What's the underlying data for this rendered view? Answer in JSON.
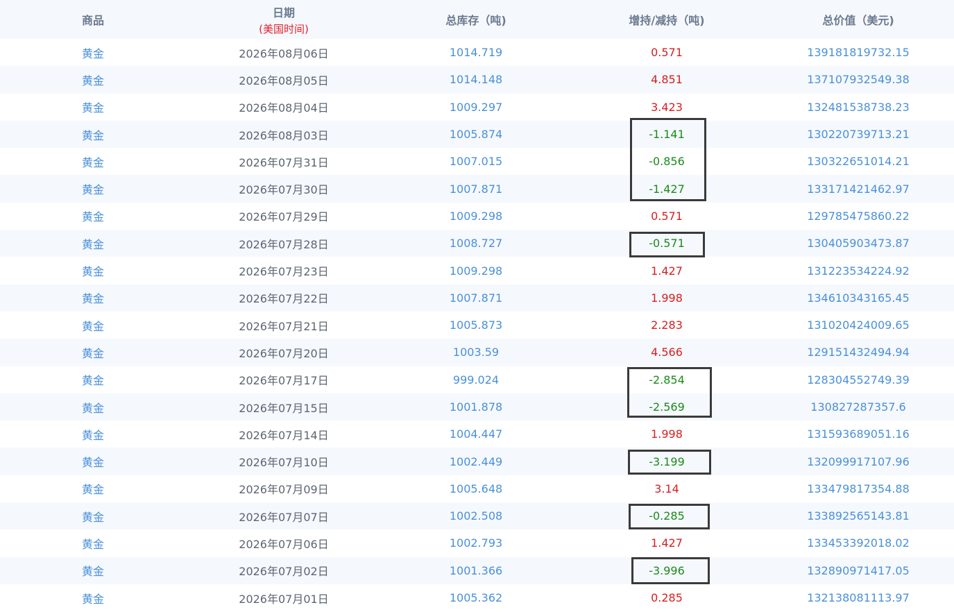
{
  "header": {
    "commodity": "商品",
    "date": "日期",
    "date_note": "(美国时间)",
    "total_stock": "总库存（吨)",
    "change": "增持/减持（吨)",
    "total_value": "总价值（美元)"
  },
  "rows": [
    {
      "commodity": "黄金",
      "date": "2026年08月06日",
      "total": "1014.719",
      "change": "0.571",
      "dir": "up",
      "value": "139181819732.15"
    },
    {
      "commodity": "黄金",
      "date": "2026年08月05日",
      "total": "1014.148",
      "change": "4.851",
      "dir": "up",
      "value": "137107932549.38"
    },
    {
      "commodity": "黄金",
      "date": "2026年08月04日",
      "total": "1009.297",
      "change": "3.423",
      "dir": "up",
      "value": "132481538738.23"
    },
    {
      "commodity": "黄金",
      "date": "2026年08月03日",
      "total": "1005.874",
      "change": "-1.141",
      "dir": "down",
      "value": "130220739713.21"
    },
    {
      "commodity": "黄金",
      "date": "2026年07月31日",
      "total": "1007.015",
      "change": "-0.856",
      "dir": "down",
      "value": "130322651014.21"
    },
    {
      "commodity": "黄金",
      "date": "2026年07月30日",
      "total": "1007.871",
      "change": "-1.427",
      "dir": "down",
      "value": "133171421462.97"
    },
    {
      "commodity": "黄金",
      "date": "2026年07月29日",
      "total": "1009.298",
      "change": "0.571",
      "dir": "up",
      "value": "129785475860.22"
    },
    {
      "commodity": "黄金",
      "date": "2026年07月28日",
      "total": "1008.727",
      "change": "-0.571",
      "dir": "down",
      "value": "130405903473.87"
    },
    {
      "commodity": "黄金",
      "date": "2026年07月23日",
      "total": "1009.298",
      "change": "1.427",
      "dir": "up",
      "value": "131223534224.92"
    },
    {
      "commodity": "黄金",
      "date": "2026年07月22日",
      "total": "1007.871",
      "change": "1.998",
      "dir": "up",
      "value": "134610343165.45"
    },
    {
      "commodity": "黄金",
      "date": "2026年07月21日",
      "total": "1005.873",
      "change": "2.283",
      "dir": "up",
      "value": "131020424009.65"
    },
    {
      "commodity": "黄金",
      "date": "2026年07月20日",
      "total": "1003.59",
      "change": "4.566",
      "dir": "up",
      "value": "129151432494.94"
    },
    {
      "commodity": "黄金",
      "date": "2026年07月17日",
      "total": "999.024",
      "change": "-2.854",
      "dir": "down",
      "value": "128304552749.39"
    },
    {
      "commodity": "黄金",
      "date": "2026年07月15日",
      "total": "1001.878",
      "change": "-2.569",
      "dir": "down",
      "value": "130827287357.6"
    },
    {
      "commodity": "黄金",
      "date": "2026年07月14日",
      "total": "1004.447",
      "change": "1.998",
      "dir": "up",
      "value": "131593689051.16"
    },
    {
      "commodity": "黄金",
      "date": "2026年07月10日",
      "total": "1002.449",
      "change": "-3.199",
      "dir": "down",
      "value": "132099917107.96"
    },
    {
      "commodity": "黄金",
      "date": "2026年07月09日",
      "total": "1005.648",
      "change": "3.14",
      "dir": "up",
      "value": "133479817354.88"
    },
    {
      "commodity": "黄金",
      "date": "2026年07月07日",
      "total": "1002.508",
      "change": "-0.285",
      "dir": "down",
      "value": "133892565143.81"
    },
    {
      "commodity": "黄金",
      "date": "2026年07月06日",
      "total": "1002.793",
      "change": "1.427",
      "dir": "up",
      "value": "133453392018.02"
    },
    {
      "commodity": "黄金",
      "date": "2026年07月02日",
      "total": "1001.366",
      "change": "-3.996",
      "dir": "down",
      "value": "132890971417.05"
    },
    {
      "commodity": "黄金",
      "date": "2026年07月01日",
      "total": "1005.362",
      "change": "0.285",
      "dir": "up",
      "value": "132138081113.97"
    }
  ],
  "colors": {
    "header_text": "#6b7a8f",
    "date_note": "#e3222d",
    "link_blue": "#4a90d9",
    "date_gray": "#5d6470",
    "increase_red": "#d81e1e",
    "decrease_green": "#1c8a1c",
    "stripe": "#f5f8fd",
    "highlight_box": "#3a3a3a"
  }
}
